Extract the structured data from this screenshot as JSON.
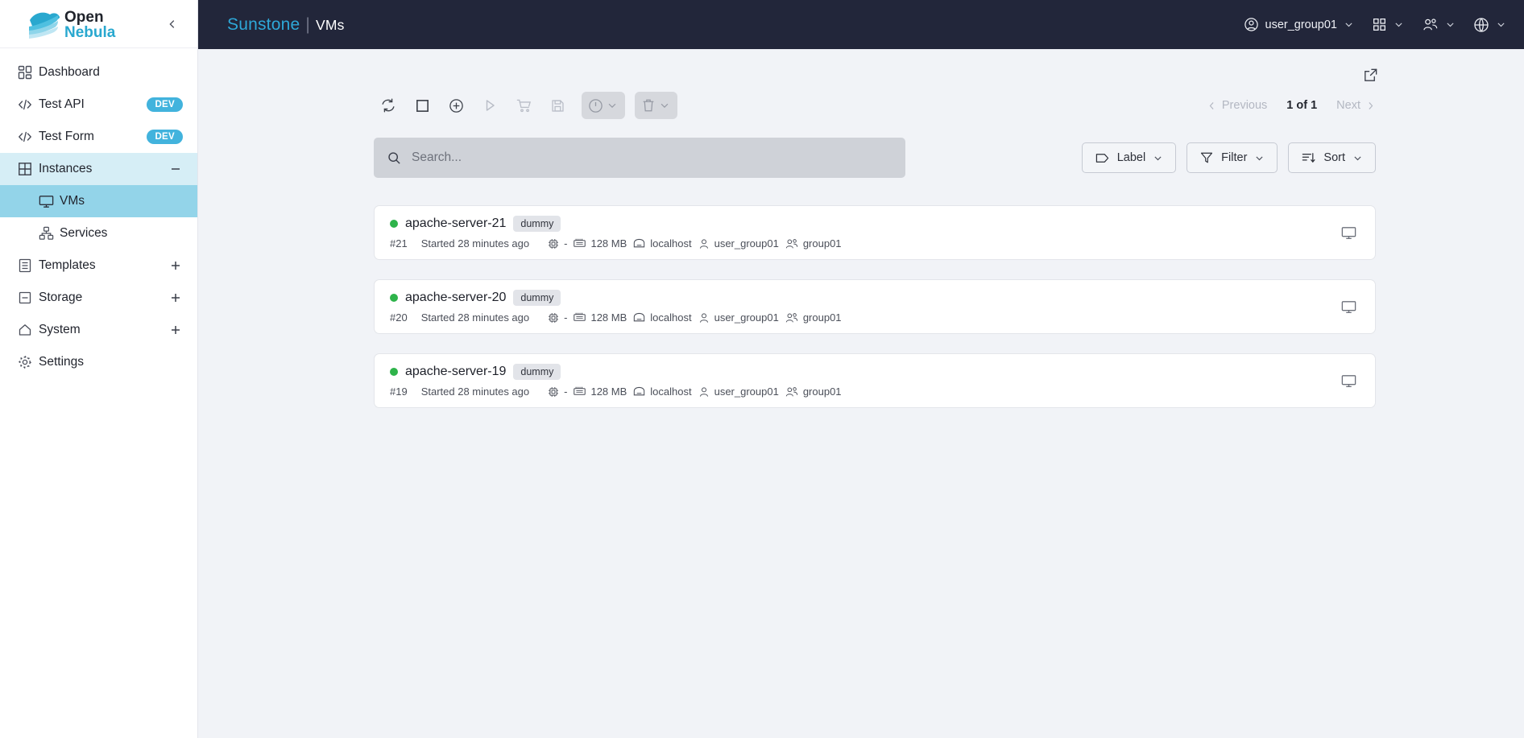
{
  "brand": {
    "name_top": "Open",
    "name_bottom": "Nebula",
    "collapse_icon": "chevron-left-icon"
  },
  "colors": {
    "topbar_bg": "#22263a",
    "brand_cyan": "#2ea8d8",
    "content_bg": "#f1f3f7",
    "nav_expanded_bg": "#d6eef6",
    "nav_active_bg": "#93d4e9",
    "dev_badge": "#42b3dd",
    "status_running": "#2eb34a"
  },
  "sidebar": {
    "items": [
      {
        "label": "Dashboard",
        "icon": "dashboard-grid-icon",
        "badge": "",
        "affix": "",
        "state": ""
      },
      {
        "label": "Test API",
        "icon": "code-icon",
        "badge": "DEV",
        "affix": "",
        "state": ""
      },
      {
        "label": "Test Form",
        "icon": "code-icon",
        "badge": "DEV",
        "affix": "",
        "state": ""
      },
      {
        "label": "Instances",
        "icon": "grid-squares-icon",
        "badge": "",
        "affix": "minus-icon",
        "state": "expanded"
      },
      {
        "label": "VMs",
        "icon": "monitor-icon",
        "badge": "",
        "affix": "",
        "state": "active",
        "sub": true
      },
      {
        "label": "Services",
        "icon": "services-nodes-icon",
        "badge": "",
        "affix": "",
        "state": "",
        "sub": true
      },
      {
        "label": "Templates",
        "icon": "template-drawer-icon",
        "badge": "",
        "affix": "plus-icon",
        "state": ""
      },
      {
        "label": "Storage",
        "icon": "storage-box-icon",
        "badge": "",
        "affix": "plus-icon",
        "state": ""
      },
      {
        "label": "System",
        "icon": "home-icon",
        "badge": "",
        "affix": "plus-icon",
        "state": ""
      },
      {
        "label": "Settings",
        "icon": "gear-icon",
        "badge": "",
        "affix": "",
        "state": ""
      }
    ]
  },
  "topbar": {
    "brand_label": "Sunstone",
    "separator": "|",
    "page_label": "VMs",
    "user_label": "user_group01",
    "user_icon": "user-circle-icon",
    "apps_icon": "grid-apps-icon",
    "group_icon": "people-group-icon",
    "language_icon": "globe-icon",
    "chevron_icon": "chevron-down-icon"
  },
  "toolbar": {
    "external_link_icon": "external-link-icon",
    "buttons": [
      {
        "name": "refresh",
        "icon": "refresh-icon",
        "disabled": false
      },
      {
        "name": "select-all",
        "icon": "square-icon",
        "disabled": false
      },
      {
        "name": "create",
        "icon": "plus-circle-icon",
        "disabled": false
      },
      {
        "name": "resume",
        "icon": "play-icon",
        "disabled": true
      },
      {
        "name": "marketplace",
        "icon": "cart-icon",
        "disabled": true
      },
      {
        "name": "save",
        "icon": "floppy-disk-icon",
        "disabled": true
      }
    ],
    "groups": [
      {
        "name": "power",
        "icon": "power-icon",
        "chevron": "chevron-down-icon"
      },
      {
        "name": "terminate",
        "icon": "trash-icon",
        "chevron": "chevron-down-icon"
      }
    ]
  },
  "pagination": {
    "previous_label": "Previous",
    "next_label": "Next",
    "count_label": "1 of 1",
    "prev_icon": "chevron-left-icon",
    "next_icon": "chevron-right-icon"
  },
  "search": {
    "placeholder": "Search...",
    "value": "",
    "icon": "search-icon"
  },
  "filters": [
    {
      "label": "Label",
      "icon": "tag-icon",
      "chevron": "chevron-down-icon"
    },
    {
      "label": "Filter",
      "icon": "funnel-icon",
      "chevron": "chevron-down-icon"
    },
    {
      "label": "Sort",
      "icon": "sort-icon",
      "chevron": "chevron-down-icon"
    }
  ],
  "vms": [
    {
      "name": "apache-server-21",
      "chip": "dummy",
      "status": "running",
      "id": "#21",
      "started": "Started 28 minutes ago",
      "cpu": "-",
      "memory": "128 MB",
      "host": "localhost",
      "owner": "user_group01",
      "group": "group01",
      "vnc_icon": "monitor-icon"
    },
    {
      "name": "apache-server-20",
      "chip": "dummy",
      "status": "running",
      "id": "#20",
      "started": "Started 28 minutes ago",
      "cpu": "-",
      "memory": "128 MB",
      "host": "localhost",
      "owner": "user_group01",
      "group": "group01",
      "vnc_icon": "monitor-icon"
    },
    {
      "name": "apache-server-19",
      "chip": "dummy",
      "status": "running",
      "id": "#19",
      "started": "Started 28 minutes ago",
      "cpu": "-",
      "memory": "128 MB",
      "host": "localhost",
      "owner": "user_group01",
      "group": "group01",
      "vnc_icon": "monitor-icon"
    }
  ]
}
